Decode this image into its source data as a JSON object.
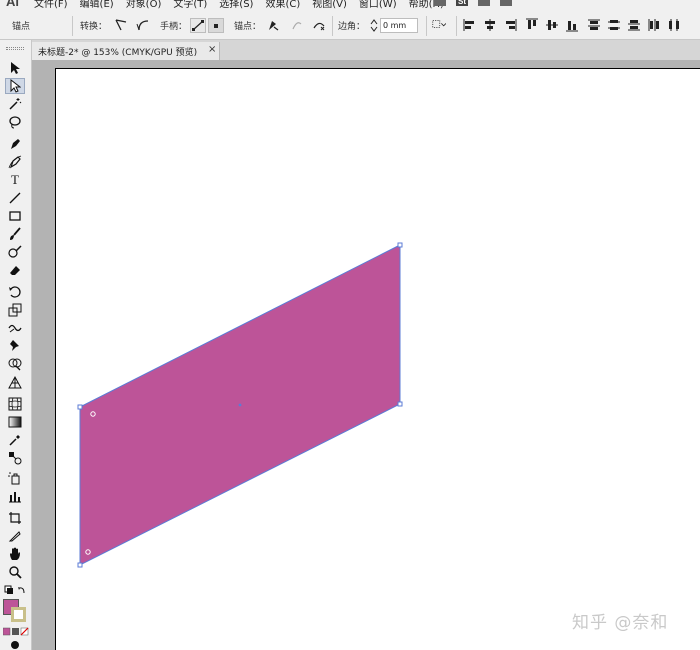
{
  "app": {
    "logo": "Ai"
  },
  "menu": [
    {
      "label": "文件(F)"
    },
    {
      "label": "编辑(E)"
    },
    {
      "label": "对象(O)"
    },
    {
      "label": "文字(T)"
    },
    {
      "label": "选择(S)"
    },
    {
      "label": "效果(C)"
    },
    {
      "label": "视图(V)"
    },
    {
      "label": "窗口(W)"
    },
    {
      "label": "帮助(H)"
    }
  ],
  "menu_right": {
    "stock_badge": "St"
  },
  "control": {
    "anchor_label": "锚点",
    "convert_label": "转换：",
    "handle_label": "手柄：",
    "anchor_points_label": "锚点：",
    "corner_label": "边角：",
    "corner_value": "0 mm"
  },
  "document": {
    "tab_title": "未标题-2* @ 153% (CMYK/GPU 预览)",
    "tab_close": "×"
  },
  "shape": {
    "fill": "#bd5498",
    "stroke": "#5b7bd6"
  },
  "toolbar": {
    "type_tool_glyph": "T",
    "fill_color": "#bd5498",
    "stroke_color": "#c9c08a"
  },
  "watermark": "知乎 @奈和"
}
